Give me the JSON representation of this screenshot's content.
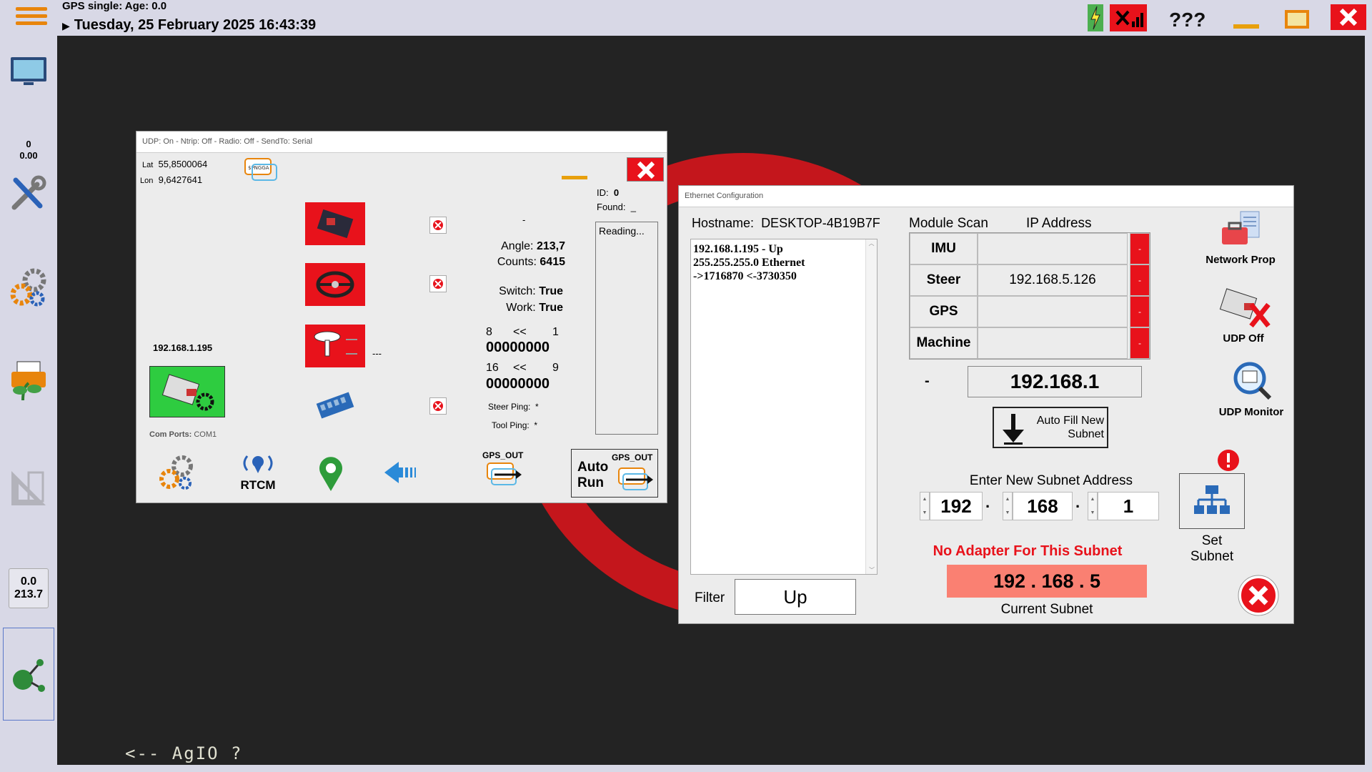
{
  "topbar": {
    "gps_status": "GPS single: Age: 0.0",
    "datetime": "Tuesday, 25 February 2025 16:43:39",
    "help_label": "???"
  },
  "sidebar": {
    "speed_top": "0",
    "speed_bottom": "0.00",
    "readout_top": "0.0",
    "readout_bottom": "213.7"
  },
  "canvas": {
    "agio_label": "<-- AgIO ?"
  },
  "agio_panel": {
    "title": "UDP: On - Ntrip: Off - Radio: Off - SendTo: Serial",
    "lat_label": "Lat",
    "lat_value": "55,8500064",
    "lon_label": "Lon",
    "lon_value": "9,6427641",
    "ip": "192.168.1.195",
    "com_ports_label": "Com Ports:",
    "com_ports_value": "COM1",
    "gps_dash": "---",
    "dash": "-",
    "id_label": "ID:",
    "id_value": "0",
    "found_label": "Found:",
    "found_value": "_",
    "reading": "Reading...",
    "angle_label": "Angle:",
    "angle_value": "213,7",
    "counts_label": "Counts:",
    "counts_value": "6415",
    "switch_label": "Switch:",
    "switch_value": "True",
    "work_label": "Work:",
    "work_value": "True",
    "bits1_left": "8",
    "bits1_mid": "<<",
    "bits1_right": "1",
    "bits1_value": "00000000",
    "bits2_left": "16",
    "bits2_mid": "<<",
    "bits2_right": "9",
    "bits2_value": "00000000",
    "steer_ping_label": "Steer Ping:",
    "steer_ping_value": "*",
    "tool_ping_label": "Tool Ping:",
    "tool_ping_value": "*",
    "rtcm_label": "RTCM",
    "gps_out_label": "GPS_OUT",
    "auto_run_label": "Auto Run",
    "gps_out_label2": "GPS_OUT",
    "nmea_tag": "$PNGGA"
  },
  "eth_panel": {
    "title": "Ethernet Configuration",
    "hostname_label": "Hostname:",
    "hostname_value": "DESKTOP-4B19B7F",
    "log_lines": [
      "192.168.1.195  - Up",
      "255.255.255.0  Ethernet",
      "->1716870  <-3730350"
    ],
    "module_scan_label": "Module Scan",
    "ip_address_label": "IP Address",
    "modules": [
      {
        "name": "IMU",
        "ip": "",
        "status": "-"
      },
      {
        "name": "Steer",
        "ip": "192.168.5.126",
        "status": "-"
      },
      {
        "name": "GPS",
        "ip": "",
        "status": "-"
      },
      {
        "name": "Machine",
        "ip": "",
        "status": "-"
      }
    ],
    "subnet_dash": "-",
    "subnet_found": "192.168.1",
    "auto_fill_label": "Auto Fill New Subnet",
    "enter_subnet_label": "Enter New Subnet Address",
    "octet1": "192",
    "octet2": "168",
    "octet3": "1",
    "set_subnet_label": "Set Subnet",
    "no_adapter_label": "No Adapter For This Subnet",
    "current_subnet_value": "192 . 168 . 5",
    "current_subnet_label": "Current Subnet",
    "filter_label": "Filter",
    "filter_value": "Up",
    "network_prop_label": "Network Prop",
    "udp_off_label": "UDP Off",
    "udp_monitor_label": "UDP Monitor"
  },
  "colors": {
    "accent_orange": "#e8850c",
    "alert_red": "#e8121b",
    "subnet_bg": "#fa8072",
    "canvas_bg": "#232323"
  }
}
